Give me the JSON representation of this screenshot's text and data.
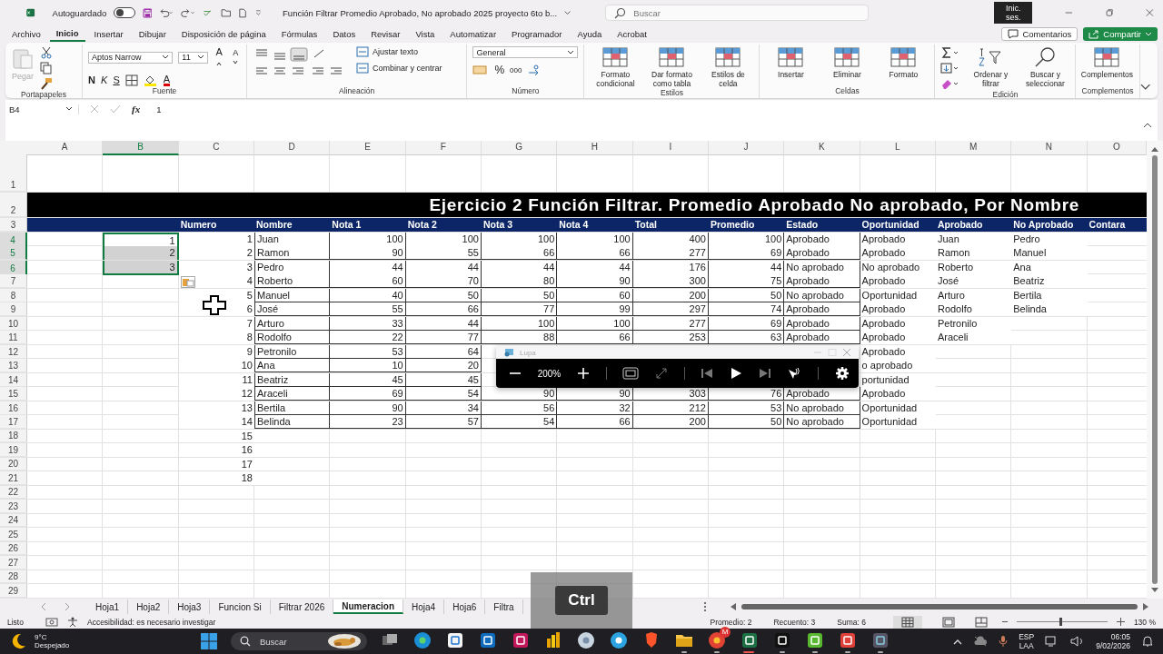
{
  "title_bar": {
    "autosave_label": "Autoguardado",
    "autosave_on": false,
    "document_title": "Función Filtrar Promedio Aprobado, No aprobado 2025 proyecto 6to b...",
    "search_placeholder": "Buscar",
    "sign_in": "Inic. ses."
  },
  "menu": [
    {
      "label": "Archivo",
      "selected": false
    },
    {
      "label": "Inicio",
      "selected": true
    },
    {
      "label": "Insertar",
      "selected": false
    },
    {
      "label": "Dibujar",
      "selected": false
    },
    {
      "label": "Disposición de página",
      "selected": false
    },
    {
      "label": "Fórmulas",
      "selected": false
    },
    {
      "label": "Datos",
      "selected": false
    },
    {
      "label": "Revisar",
      "selected": false
    },
    {
      "label": "Vista",
      "selected": false
    },
    {
      "label": "Automatizar",
      "selected": false
    },
    {
      "label": "Programador",
      "selected": false
    },
    {
      "label": "Ayuda",
      "selected": false
    },
    {
      "label": "Acrobat",
      "selected": false
    }
  ],
  "comments_button": "Comentarios",
  "share_button": "Compartir",
  "ribbon": [
    {
      "kind": "clipboard",
      "label": "Portapapeles",
      "buttons": [
        "Pegar"
      ]
    },
    {
      "kind": "font",
      "label": "Fuente",
      "font": "Aptos Narrow",
      "size": "11",
      "size_buttons": [
        "A",
        "A"
      ],
      "styles": [
        "N",
        "K",
        "S"
      ],
      "color_letter": "A"
    },
    {
      "kind": "align",
      "label": "Alineación",
      "buttons": [
        "Ajustar texto",
        "Combinar y centrar"
      ]
    },
    {
      "kind": "number",
      "label": "Número",
      "format": "General",
      "symbols": [
        "%",
        "000"
      ]
    },
    {
      "kind": "large",
      "label": "Estilos",
      "buttons": [
        "Formato condicional",
        "Dar formato como tabla",
        "Estilos de celda"
      ]
    },
    {
      "kind": "large",
      "label": "Celdas",
      "buttons": [
        "Insertar",
        "Eliminar",
        "Formato"
      ]
    },
    {
      "kind": "editing",
      "label": "Edición",
      "buttons": [
        "Ordenar y filtrar",
        "Buscar y seleccionar"
      ]
    },
    {
      "kind": "large",
      "label": "Complementos",
      "buttons": [
        "Complementos"
      ]
    }
  ],
  "formula_bar": {
    "name_box": "B4",
    "function_label": "fx",
    "value": "1"
  },
  "columns": [
    {
      "label": "A",
      "selected": false
    },
    {
      "label": "B",
      "selected": true
    },
    {
      "label": "C",
      "selected": false
    },
    {
      "label": "D",
      "selected": false
    },
    {
      "label": "E",
      "selected": false
    },
    {
      "label": "F",
      "selected": false
    },
    {
      "label": "G",
      "selected": false
    },
    {
      "label": "H",
      "selected": false
    },
    {
      "label": "I",
      "selected": false
    },
    {
      "label": "J",
      "selected": false
    },
    {
      "label": "K",
      "selected": false
    },
    {
      "label": "L",
      "selected": false
    },
    {
      "label": "M",
      "selected": false
    },
    {
      "label": "N",
      "selected": false
    },
    {
      "label": "O",
      "selected": false
    }
  ],
  "rows": [
    {
      "number": "1",
      "kind": "empty",
      "selected": false
    },
    {
      "number": "2",
      "kind": "title",
      "selected": false,
      "title": "Ejercicio 2 Función Filtrar. Promedio Aprobado No aprobado, Por Nombre"
    },
    {
      "number": "3",
      "kind": "header",
      "selected": false,
      "cells": [
        null,
        null,
        "Numero",
        "Nombre",
        "Nota 1",
        "Nota 2",
        "Nota 3",
        "Nota 4",
        "Total",
        "Promedio",
        "Estado",
        "Oportunidad",
        "Aprobado",
        "No Aprobado",
        "Contara"
      ]
    },
    {
      "number": "4",
      "kind": "record",
      "selected": true,
      "active": true,
      "cells": [
        null,
        "1",
        "1",
        "Juan",
        "100",
        "100",
        "100",
        "100",
        "400",
        "100",
        "Aprobado",
        "Aprobado",
        "Juan",
        "Pedro",
        null
      ]
    },
    {
      "number": "5",
      "kind": "record",
      "selected": true,
      "active": false,
      "cells": [
        null,
        "2",
        "2",
        "Ramon",
        "90",
        "55",
        "66",
        "66",
        "277",
        "69",
        "Aprobado",
        "Aprobado",
        "Ramon",
        "Manuel",
        null
      ]
    },
    {
      "number": "6",
      "kind": "record",
      "selected": true,
      "active": false,
      "cells": [
        null,
        "3",
        "3",
        "Pedro",
        "44",
        "44",
        "44",
        "44",
        "176",
        "44",
        "No aprobado",
        "No aprobado",
        "Roberto",
        "Ana",
        null
      ]
    },
    {
      "number": "7",
      "kind": "record",
      "selected": false,
      "cells": [
        null,
        null,
        "4",
        "Roberto",
        "60",
        "70",
        "80",
        "90",
        "300",
        "75",
        "Aprobado",
        "Aprobado",
        "José",
        "Beatriz",
        null
      ]
    },
    {
      "number": "8",
      "kind": "record",
      "selected": false,
      "cells": [
        null,
        null,
        "5",
        "Manuel",
        "40",
        "50",
        "50",
        "60",
        "200",
        "50",
        "No aprobado",
        "Oportunidad",
        "Arturo",
        "Bertila",
        null
      ]
    },
    {
      "number": "9",
      "kind": "record",
      "selected": false,
      "cells": [
        null,
        null,
        "6",
        "José",
        "55",
        "66",
        "77",
        "99",
        "297",
        "74",
        "Aprobado",
        "Aprobado",
        "Rodolfo",
        "Belinda",
        null
      ]
    },
    {
      "number": "10",
      "kind": "record",
      "selected": false,
      "cells": [
        null,
        null,
        "7",
        "Arturo",
        "33",
        "44",
        "100",
        "100",
        "277",
        "69",
        "Aprobado",
        "Aprobado",
        "Petronilo",
        null,
        null
      ]
    },
    {
      "number": "11",
      "kind": "record",
      "selected": false,
      "cells": [
        null,
        null,
        "8",
        "Rodolfo",
        "22",
        "77",
        "88",
        "66",
        "253",
        "63",
        "Aprobado",
        "Aprobado",
        "Araceli",
        null,
        null
      ]
    },
    {
      "number": "12",
      "kind": "record",
      "selected": false,
      "cells": [
        null,
        null,
        "9",
        "Petronilo",
        "53",
        "64",
        null,
        null,
        null,
        null,
        null,
        "Aprobado",
        null,
        null,
        null
      ]
    },
    {
      "number": "13",
      "kind": "record",
      "selected": false,
      "cells": [
        null,
        null,
        "10",
        "Ana",
        "10",
        "20",
        null,
        null,
        null,
        null,
        null,
        "o aprobado",
        null,
        null,
        null
      ]
    },
    {
      "number": "14",
      "kind": "record",
      "selected": false,
      "cells": [
        null,
        null,
        "11",
        "Beatriz",
        "45",
        "45",
        null,
        null,
        null,
        null,
        null,
        "portunidad",
        null,
        null,
        null
      ]
    },
    {
      "number": "15",
      "kind": "record",
      "selected": false,
      "cells": [
        null,
        null,
        "12",
        "Araceli",
        "69",
        "54",
        "90",
        "90",
        "303",
        "76",
        "Aprobado",
        "Aprobado",
        null,
        null,
        null
      ]
    },
    {
      "number": "16",
      "kind": "record",
      "selected": false,
      "cells": [
        null,
        null,
        "13",
        "Bertila",
        "90",
        "34",
        "56",
        "32",
        "212",
        "53",
        "No aprobado",
        "Oportunidad",
        null,
        null,
        null
      ]
    },
    {
      "number": "17",
      "kind": "record",
      "selected": false,
      "cells": [
        null,
        null,
        "14",
        "Belinda",
        "23",
        "57",
        "54",
        "66",
        "200",
        "50",
        "No aprobado",
        "Oportunidad",
        null,
        null,
        null
      ]
    },
    {
      "number": "18",
      "kind": "plain",
      "selected": false,
      "cells": [
        null,
        null,
        "15"
      ]
    },
    {
      "number": "19",
      "kind": "plain",
      "selected": false,
      "cells": [
        null,
        null,
        "16"
      ]
    },
    {
      "number": "20",
      "kind": "plain",
      "selected": false,
      "cells": [
        null,
        null,
        "17"
      ]
    },
    {
      "number": "21",
      "kind": "plain",
      "selected": false,
      "cells": [
        null,
        null,
        "18"
      ]
    },
    {
      "number": "22",
      "kind": "plain",
      "selected": false
    },
    {
      "number": "23",
      "kind": "plain",
      "selected": false
    },
    {
      "number": "24",
      "kind": "plain",
      "selected": false
    },
    {
      "number": "25",
      "kind": "plain",
      "selected": false
    },
    {
      "number": "26",
      "kind": "plain",
      "selected": false
    },
    {
      "number": "27",
      "kind": "plain",
      "selected": false
    },
    {
      "number": "28",
      "kind": "plain",
      "selected": false
    },
    {
      "number": "29",
      "kind": "plain",
      "selected": false
    }
  ],
  "magnifier": {
    "title": "Lupa",
    "zoom": "200%"
  },
  "key_overlay": "Ctrl",
  "sheet_tabs": [
    {
      "label": "Hoja1",
      "selected": false
    },
    {
      "label": "Hoja2",
      "selected": false
    },
    {
      "label": "Hoja3",
      "selected": false
    },
    {
      "label": "Funcion Si",
      "selected": false
    },
    {
      "label": "Filtrar 2026",
      "selected": false
    },
    {
      "label": "Numeracion",
      "selected": true
    },
    {
      "label": "Hoja4",
      "selected": false
    },
    {
      "label": "Hoja6",
      "selected": false
    },
    {
      "label": "Filtra",
      "selected": false
    }
  ],
  "status_bar": {
    "ready": "Listo",
    "accessibility": "Accesibilidad: es necesario investigar",
    "average": "Promedio: 2",
    "count": "Recuento: 3",
    "sum": "Suma: 6",
    "zoom_slider": {
      "level": 0.47
    },
    "zoom": "130 %"
  },
  "taskbar": {
    "temperature": "9°C",
    "weather": "Despejado",
    "search_placeholder": "Buscar",
    "apps": [
      {
        "kind": "taskview",
        "running": false
      },
      {
        "kind": "edge",
        "running": false
      },
      {
        "kind": "store",
        "running": false
      },
      {
        "kind": "mail",
        "running": false
      },
      {
        "kind": "camera",
        "running": false
      },
      {
        "kind": "chart",
        "running": false
      },
      {
        "kind": "disc",
        "running": false
      },
      {
        "kind": "telegram",
        "running": false
      },
      {
        "kind": "shield",
        "running": false
      },
      {
        "kind": "folder",
        "running": true
      },
      {
        "kind": "chrome",
        "running": true,
        "badge": "M"
      },
      {
        "kind": "excel",
        "running": true
      },
      {
        "kind": "arrow",
        "running": true
      },
      {
        "kind": "green",
        "running": true
      },
      {
        "kind": "red",
        "running": true
      },
      {
        "kind": "magnifier",
        "running": true
      }
    ],
    "language": "ESP",
    "layout": "LAA",
    "time": "06:05",
    "date": "9/02/2026"
  }
}
